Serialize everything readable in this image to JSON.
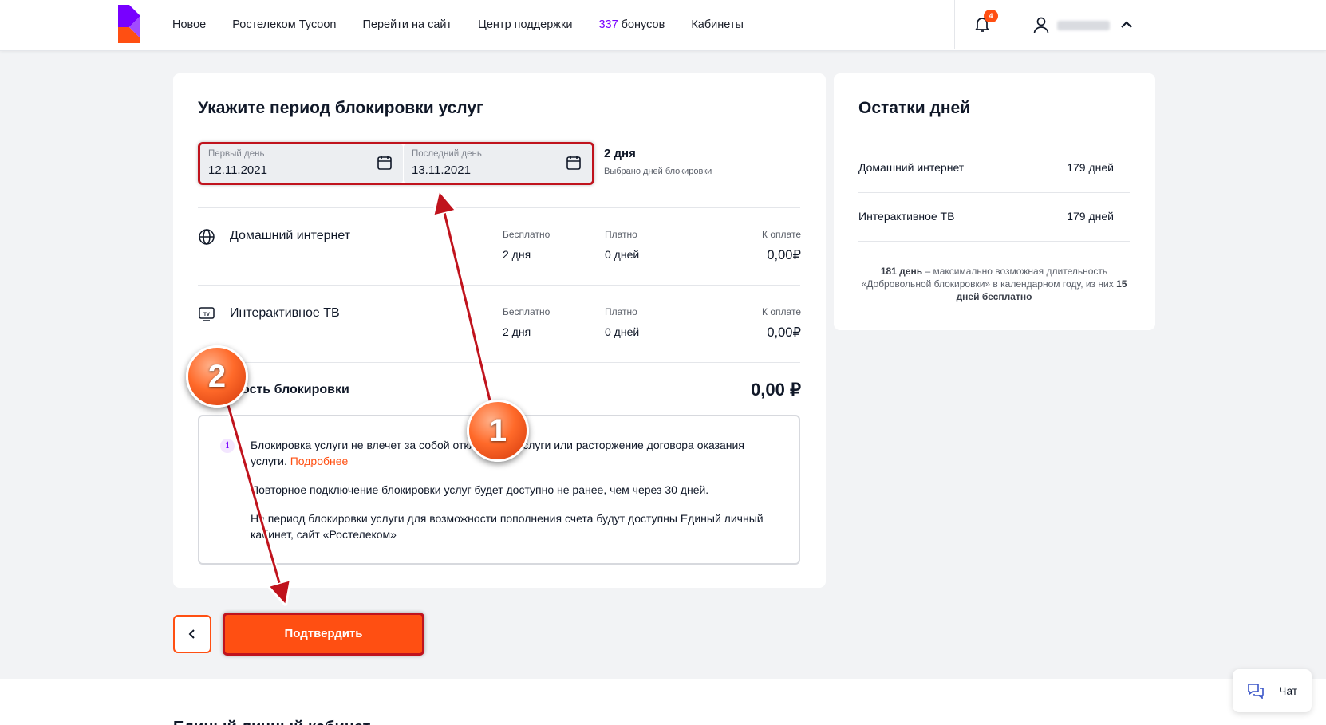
{
  "header": {
    "nav": [
      "Новое",
      "Ростелеком Tycoon",
      "Перейти на сайт",
      "Центр поддержки"
    ],
    "bonus_count": "337",
    "bonus_label": " бонусов",
    "nav_last": "Кабинеты",
    "notifications_count": "4"
  },
  "main": {
    "title": "Укажите период блокировки услуг",
    "first_day_label": "Первый день",
    "first_day_value": "12.11.2021",
    "last_day_label": "Последний день",
    "last_day_value": "13.11.2021",
    "days_count": "2 дня",
    "days_sub": "Выбрано дней блокировки",
    "columns": {
      "free": "Бесплатно",
      "paid": "Платно",
      "to_pay": "К оплате"
    },
    "services": [
      {
        "name": "Домашний интернет",
        "icon": "globe-icon",
        "free": "2 дня",
        "paid": "0 дней",
        "to_pay": "0,00₽"
      },
      {
        "name": "Интерактивное ТВ",
        "icon": "tv-icon",
        "free": "2 дня",
        "paid": "0 дней",
        "to_pay": "0,00₽"
      }
    ],
    "total_label": "ость блокировки",
    "total_value": "0,00 ₽",
    "info": {
      "p1": "Блокировка услуги не влечет за собой отключение услуги или расторжение договора оказания услуги.",
      "p1_link": "Подробнее",
      "p2": "Повторное подключение блокировки услуг будет доступно не ранее, чем через 30 дней.",
      "p3": "На период блокировки услуги для возможности пополнения счета будут доступны Единый личный кабинет, сайт «Ростелеком»"
    }
  },
  "side": {
    "title": "Остатки дней",
    "rows": [
      {
        "label": "Домашний интернет",
        "value": "179 дней"
      },
      {
        "label": "Интерактивное ТВ",
        "value": "179 дней"
      }
    ],
    "note_bold1": "181 день",
    "note_text1": " – максимально возможная длительность «Добровольной блокировки» в календарном году, из них ",
    "note_bold2": "15 дней бесплатно"
  },
  "actions": {
    "confirm": "Подтвердить"
  },
  "footer": {
    "title": "Единый личный кабинет"
  },
  "chat": {
    "label": "Чат"
  },
  "annotations": [
    "1",
    "2"
  ],
  "colors": {
    "accent": "#ff4f12",
    "brand_purple": "#7800ff",
    "annotation_red": "#c0131d"
  }
}
